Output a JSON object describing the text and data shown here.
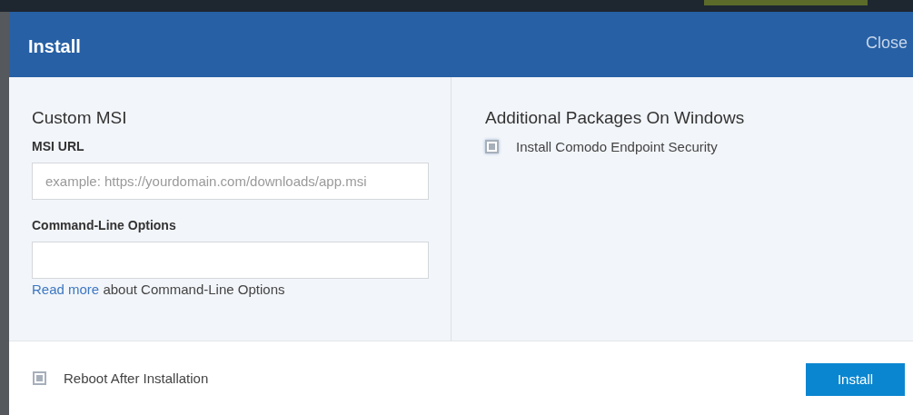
{
  "dialog": {
    "title": "Install",
    "close": "Close"
  },
  "custom_msi": {
    "heading": "Custom MSI",
    "msi_url": {
      "label": "MSI URL",
      "placeholder": "example: https://yourdomain.com/downloads/app.msi"
    },
    "command_line": {
      "label": "Command-Line Options",
      "link": "Read more",
      "help_rest": "about Command-Line Options"
    }
  },
  "additional_packages": {
    "heading": "Additional Packages On Windows",
    "options": [
      {
        "label": "Install Comodo Endpoint Security",
        "checked": true
      }
    ]
  },
  "footer": {
    "reboot": {
      "label": "Reboot After Installation",
      "checked": true
    },
    "button": "Install"
  }
}
